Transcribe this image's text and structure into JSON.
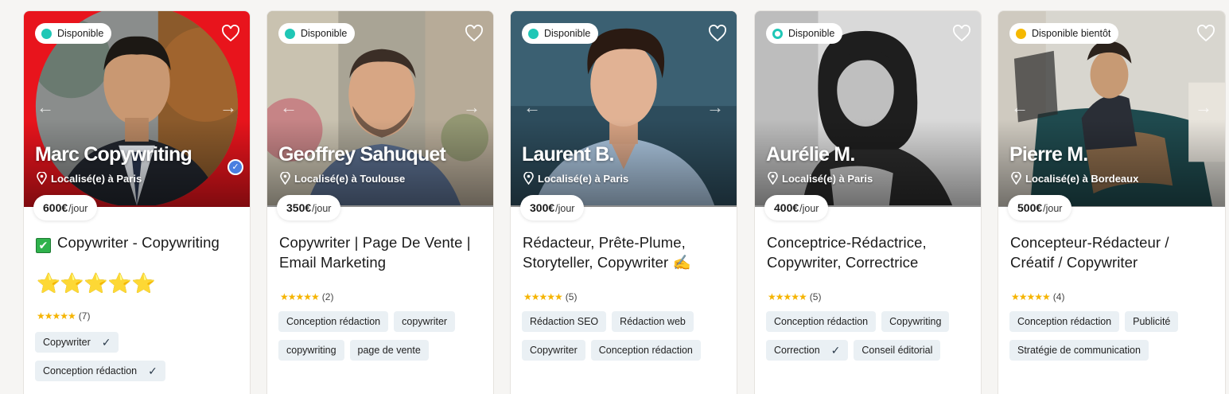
{
  "cards": [
    {
      "availability": "Disponible",
      "availability_color": "#1fc7b6",
      "name": "Marc Copywriting",
      "location": "Localisé(e) à Paris",
      "price": "600€",
      "price_unit": "/jour",
      "title_emoji": "✔",
      "title": "Copywriter - Copywriting",
      "title_stars": "⭐⭐⭐⭐⭐",
      "rating_stars": "★★★★★",
      "review_count": "(7)",
      "verified": true,
      "tags": [
        "Copywriter",
        "Conception rédaction"
      ],
      "tag_checks": [
        "✓",
        "✓"
      ]
    },
    {
      "availability": "Disponible",
      "availability_color": "#1fc7b6",
      "name": "Geoffrey Sahuquet",
      "location": "Localisé(e) à Toulouse",
      "price": "350€",
      "price_unit": "/jour",
      "title": "Copywriter | Page De Vente | Email Marketing",
      "rating_stars": "★★★★★",
      "review_count": "(2)",
      "tags": [
        "Conception rédaction",
        "copywriter",
        "copywriting",
        "page de vente"
      ]
    },
    {
      "availability": "Disponible",
      "availability_color": "#1fc7b6",
      "name": "Laurent B.",
      "location": "Localisé(e) à Paris",
      "price": "300€",
      "price_unit": "/jour",
      "title": "Rédacteur, Prête-Plume, Storyteller, Copywriter ✍️",
      "rating_stars": "★★★★★",
      "review_count": "(5)",
      "tags": [
        "Rédaction SEO",
        "Rédaction web",
        "Copywriter",
        "Conception rédaction"
      ]
    },
    {
      "availability": "Disponible",
      "availability_color": "#1fc7b6",
      "name": "Aurélie M.",
      "location": "Localisé(e) à Paris",
      "price": "400€",
      "price_unit": "/jour",
      "title": "Conceptrice-Rédactrice, Copywriter, Correctrice",
      "rating_stars": "★★★★★",
      "review_count": "(5)",
      "tags": [
        "Conception rédaction",
        "Copywriting",
        "Correction",
        "Conseil éditorial"
      ],
      "tag_checks": [
        "",
        "",
        "✓",
        ""
      ]
    },
    {
      "availability": "Disponible bientôt",
      "availability_color": "#f5b800",
      "name": "Pierre M.",
      "location": "Localisé(e) à Bordeaux",
      "price": "500€",
      "price_unit": "/jour",
      "title": "Concepteur-Rédacteur / Créatif / Copywriter",
      "rating_stars": "★★★★★",
      "review_count": "(4)",
      "tags": [
        "Conception rédaction",
        "Publicité",
        "Stratégie de communication"
      ]
    }
  ],
  "icons": {
    "favorite": "heart-outline-icon",
    "prev": "arrow-left-icon",
    "next": "arrow-right-icon",
    "location": "map-pin-icon",
    "verified": "verified-check-icon"
  }
}
